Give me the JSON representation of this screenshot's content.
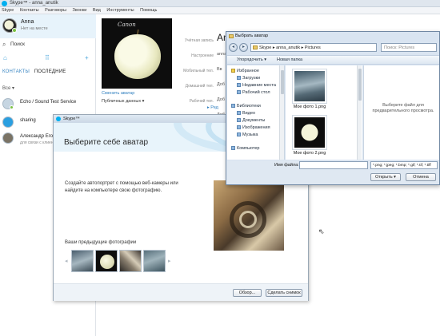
{
  "skype": {
    "title": "Skype™ - anna_anutik",
    "menu": [
      "Skype",
      "Контакты",
      "Разговоры",
      "Звонки",
      "Вид",
      "Инструменты",
      "Помощь"
    ],
    "profile": {
      "name": "Anna",
      "status": "Нет на месте"
    },
    "search_label": "Поиск",
    "tabs": {
      "contacts": "КОНТАКТЫ",
      "recent": "ПОСЛЕДНИЕ"
    },
    "filter": "Все",
    "contacts": [
      {
        "name": "Echo / Sound Test Service",
        "sub": ""
      },
      {
        "name": "sharing",
        "sub": ""
      },
      {
        "name": "Александр Его...",
        "sub": "для связи с клиентами..."
      }
    ],
    "profile_panel": {
      "name": "Anna",
      "change_avatar": "Сменить аватар",
      "public_data": "Публичных данных ▾",
      "field_labels": [
        "Учётная запись",
        "Настроение",
        "Мобильный тел.",
        "Домашний тел.",
        "Рабочий тел."
      ],
      "field_values": [
        "anna_anutik",
        "Вв",
        "Доб",
        "Доб",
        "Доб"
      ],
      "more_link": "Ред"
    }
  },
  "avatar_dialog": {
    "title": "Skype™",
    "heading": "Выберите себе аватар",
    "description": "Создайте автопортрет с помощью веб-камеры или найдите на компьютере свою фотографию.",
    "previous_label": "Ваши предыдущие фотографии",
    "browse_button": "Обзор...",
    "snapshot_button": "Сделать снимок"
  },
  "file_dialog": {
    "title": "Выбрать аватар",
    "path": "Skype ▸ anna_anutik ▸ Pictures",
    "search_placeholder": "Поиск: Pictures",
    "toolbar": {
      "organize": "Упорядочить ▾",
      "new_folder": "Новая папка"
    },
    "nav": {
      "favorites": "Избранное",
      "favorites_items": [
        "Загрузки",
        "Недавние места",
        "Рабочий стол"
      ],
      "libraries": "Библиотеки",
      "libraries_items": [
        "Видео",
        "Документы",
        "Изображения",
        "Музыка"
      ],
      "computer": "Компьютер"
    },
    "files": [
      "Мое фото 1.png",
      "Мое фото 2.png"
    ],
    "preview_message": "Выберите файл для предварительного просмотра.",
    "filename_label": "Имя файла:",
    "filename_value": "",
    "filetype": "*.png; *.jpeg; *.bmp; *.gif; *.tif; *.tiff",
    "open_button": "Открыть ▾",
    "cancel_button": "Отмена"
  }
}
